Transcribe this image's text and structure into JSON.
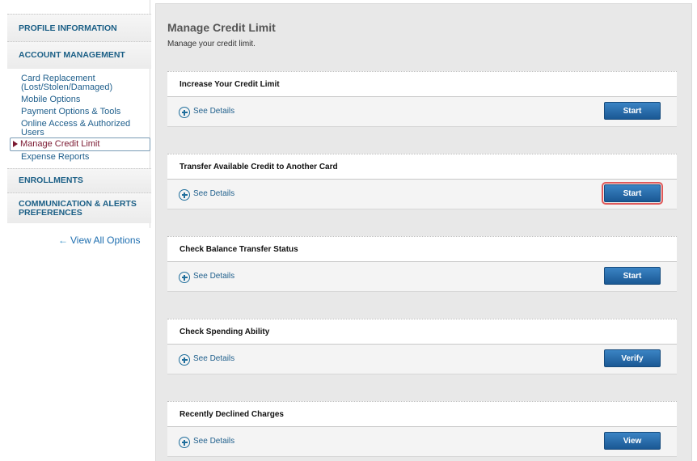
{
  "sidebar": {
    "sections": [
      {
        "title": "PROFILE INFORMATION"
      },
      {
        "title": "ACCOUNT MANAGEMENT"
      },
      {
        "title": "ENROLLMENTS"
      },
      {
        "title": "COMMUNICATION & ALERTS PREFERENCES"
      }
    ],
    "account_items": [
      {
        "label": "Card Replacement (Lost/Stolen/Damaged)"
      },
      {
        "label": "Mobile Options"
      },
      {
        "label": "Payment Options & Tools"
      },
      {
        "label": "Online Access & Authorized Users"
      },
      {
        "label": "Manage Credit Limit",
        "active": true
      },
      {
        "label": "Expense Reports"
      }
    ],
    "view_all": "View All Options",
    "view_all_icon": "arrow-left-icon"
  },
  "main": {
    "title": "Manage Credit Limit",
    "subtitle": "Manage your credit limit.",
    "details_label": "See Details",
    "cards": [
      {
        "title": "Increase Your Credit Limit",
        "button": "Start"
      },
      {
        "title": "Transfer Available Credit to Another Card",
        "button": "Start",
        "highlighted": true
      },
      {
        "title": "Check Balance Transfer Status",
        "button": "Start"
      },
      {
        "title": "Check Spending Ability",
        "button": "Verify"
      },
      {
        "title": "Recently Declined Charges",
        "button": "View"
      }
    ]
  },
  "colors": {
    "link": "#1f5f8c",
    "section_heading": "#1b5f86",
    "active_item": "#7a1830",
    "button": "#1f60a0",
    "highlight_outline": "#e05a5a",
    "panel_background": "#e8e8e8"
  }
}
